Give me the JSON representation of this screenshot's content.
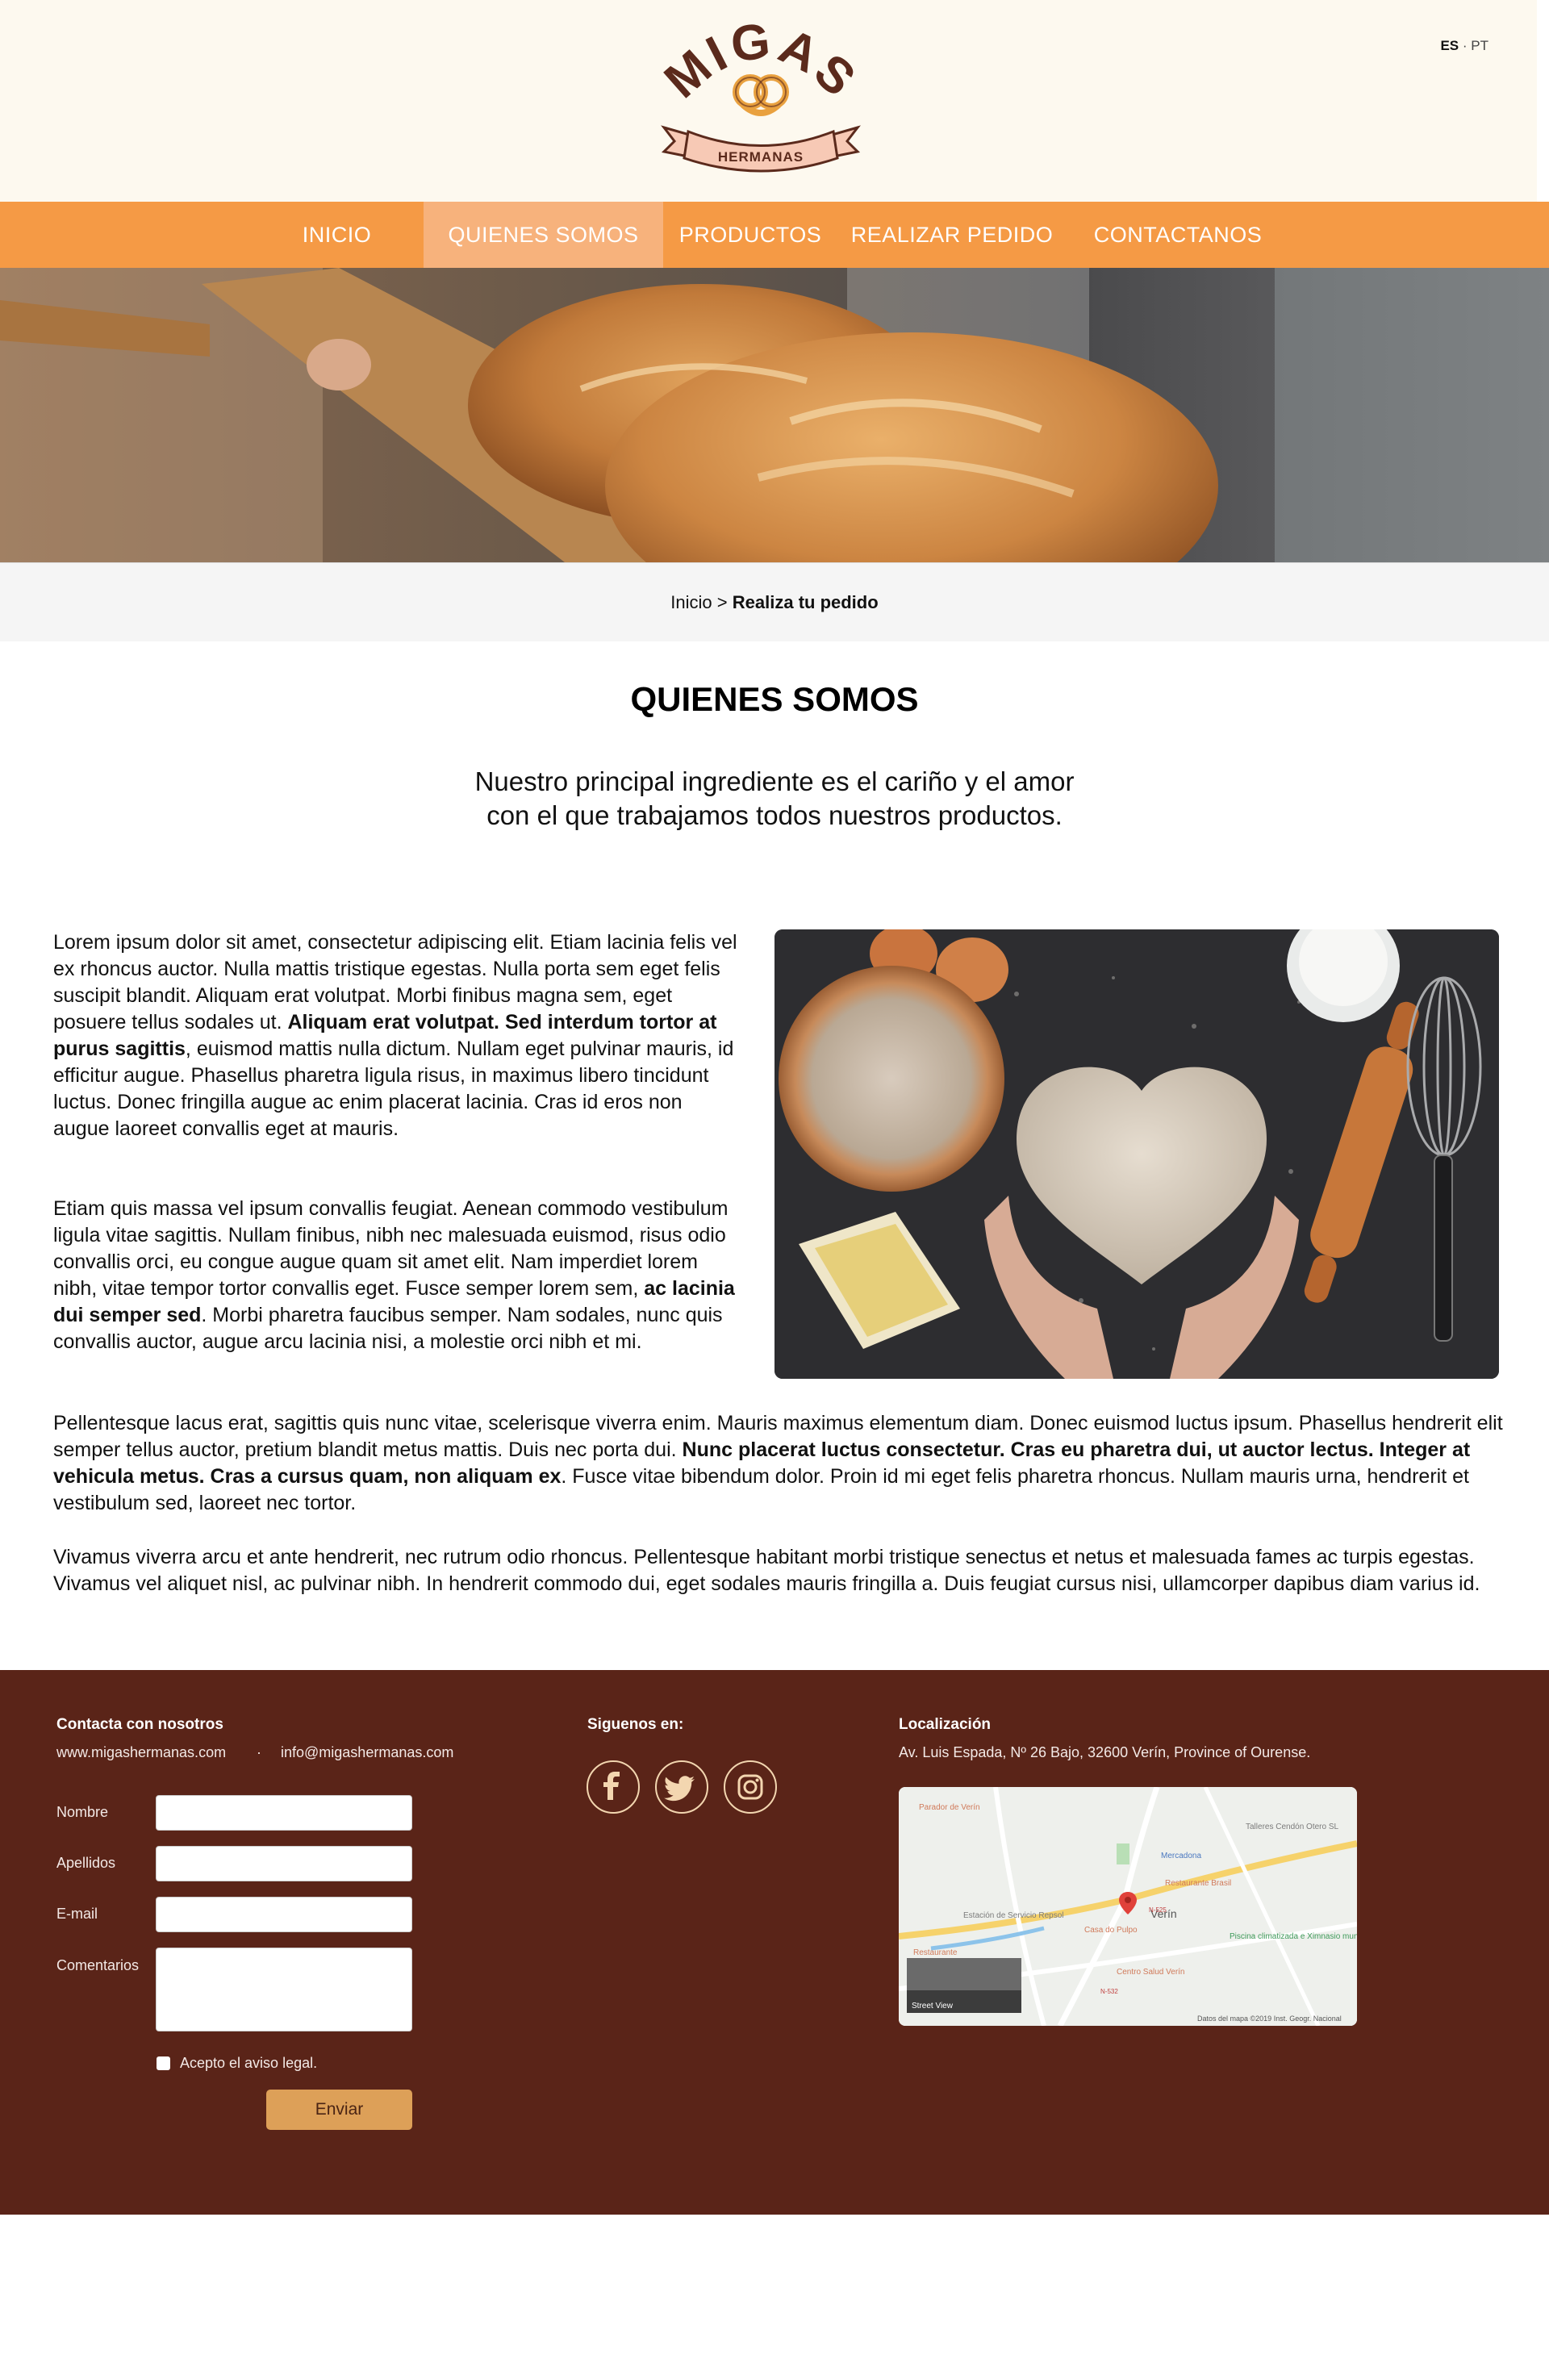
{
  "header": {
    "logo": {
      "word": "MIGAS",
      "ribbon": "HERMANAS"
    },
    "lang": {
      "active": "ES",
      "separator": "·",
      "other": "PT"
    }
  },
  "nav": {
    "items": [
      {
        "label": "INICIO"
      },
      {
        "label": "QUIENES SOMOS",
        "active": true
      },
      {
        "label": "PRODUCTOS"
      },
      {
        "label": "REALIZAR PEDIDO"
      },
      {
        "label": "CONTACTANOS"
      }
    ]
  },
  "breadcrumb": {
    "home": "Inicio",
    "separator": ">",
    "current": "Realiza tu pedido"
  },
  "main": {
    "title": "QUIENES SOMOS",
    "subtitle_line1": "Nuestro principal ingrediente es el cariño y el amor",
    "subtitle_line2": "con el que trabajamos todos nuestros productos.",
    "p1_a": "Lorem ipsum dolor sit amet, consectetur adipiscing elit. Etiam lacinia felis vel ex rhoncus auctor. Nulla mattis tristique egestas. Nulla porta sem eget felis suscipit blandit. Aliquam erat volutpat. Morbi finibus magna sem, eget posuere tellus sodales ut. ",
    "p1_b": "Aliquam erat volutpat. Sed interdum tortor at purus sagittis",
    "p1_c": ", euismod mattis nulla dictum. Nullam eget pulvinar mauris, id efficitur augue. Phasellus pharetra ligula risus, in maximus libero tincidunt luctus. Donec fringilla augue ac enim placerat lacinia. Cras id eros non augue laoreet convallis eget at mauris.",
    "p2_a": "Etiam quis massa vel ipsum convallis feugiat. Aenean commodo vestibulum ligula vitae sagittis. Nullam finibus, nibh nec malesuada euismod, risus odio convallis orci, eu congue augue quam sit amet elit. Nam imperdiet lorem nibh, vitae tempor tortor convallis eget. Fusce semper lorem sem, ",
    "p2_b": "ac lacinia dui semper sed",
    "p2_c": ". Morbi pharetra faucibus semper. Nam sodales, nunc quis convallis auctor, augue arcu lacinia nisi, a molestie orci nibh et mi.",
    "p3_a": "Pellentesque lacus erat, sagittis quis nunc vitae, scelerisque viverra enim. Mauris maximus elementum diam. Donec euismod luctus ipsum. Phasellus hendrerit elit semper tellus auctor, pretium blandit metus mattis. Duis nec porta dui. ",
    "p3_b": "Nunc placerat luctus consectetur. Cras eu pharetra dui, ut auctor lectus. Integer at vehicula metus. Cras a cursus quam, non aliquam ex",
    "p3_c": ". Fusce vitae bibendum dolor. Proin id mi eget felis pharetra rhoncus. Nullam mauris urna, hendrerit et vestibulum sed, laoreet nec tortor.",
    "p4": "Vivamus viverra arcu et ante hendrerit, nec rutrum odio rhoncus. Pellentesque habitant morbi tristique senectus et netus et malesuada fames ac turpis egestas. Vivamus vel aliquet nisl, ac pulvinar nibh. In hendrerit commodo dui, eget sodales mauris fringilla a. Duis feugiat cursus nisi, ullamcorper dapibus diam varius id."
  },
  "footer": {
    "contact_heading": "Contacta con nosotros",
    "website": "www.migashermanas.com",
    "dot": "·",
    "email": "info@migashermanas.com",
    "form": {
      "name_label": "Nombre",
      "surname_label": "Apellidos",
      "email_label": "E-mail",
      "comments_label": "Comentarios",
      "legal_label": "Acepto el aviso legal.",
      "submit_label": "Enviar"
    },
    "social_heading": "Siguenos en:",
    "social": [
      "facebook-icon",
      "twitter-icon",
      "instagram-icon"
    ],
    "location_heading": "Localización",
    "address": "Av. Luis Espada, Nº 26 Bajo, 32600 Verín, Province of Ourense.",
    "map": {
      "labels": {
        "parador": "Parador de Verín",
        "talleres": "Talleres Cendón Otero SL",
        "mercadona": "Mercadona",
        "restaurante_brasil": "Restaurante Brasil",
        "estacion": "Estación de Servicio Repsol",
        "verin": "Verín",
        "casa_pulpo": "Casa do Pulpo",
        "piscina": "Piscina climatizada e Ximnasio municipal",
        "restaurante": "Restaurante",
        "centro_salud": "Centro Salud Verín",
        "street_view": "Street View",
        "attribution": "Datos del mapa ©2019 Inst. Geogr. Nacional",
        "road_n525": "N-525",
        "road_n532": "N-532"
      }
    }
  },
  "colors": {
    "header_bg": "#fdf9ef",
    "nav_bg": "#f59a45",
    "nav_active": "#f7b27c",
    "footer_bg": "#5a2418",
    "button": "#dda058",
    "logo_brown": "#5b2a1c",
    "ribbon_pink": "#f7c9b5"
  }
}
